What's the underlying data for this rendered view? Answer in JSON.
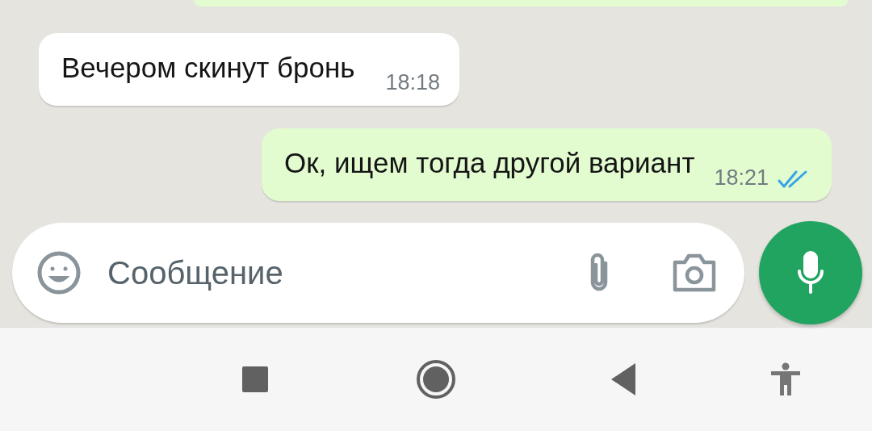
{
  "messages": [
    {
      "kind": "incoming",
      "text": "Вечером скинут бронь",
      "time": "18:18"
    },
    {
      "kind": "outgoing",
      "text": "Ок, ищем тогда другой вариант",
      "time": "18:21",
      "read": true
    }
  ],
  "composer": {
    "placeholder": "Сообщение"
  }
}
